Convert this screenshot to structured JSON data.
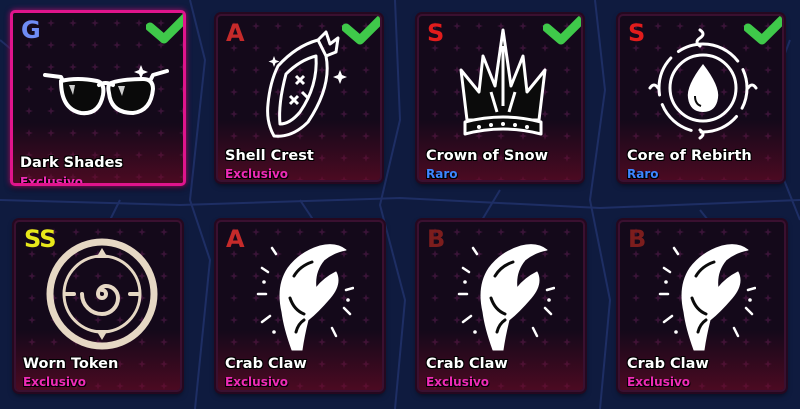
{
  "colors": {
    "grade_G": "#6f8cf5",
    "grade_A": "#c62a2a",
    "grade_S": "#e11c1c",
    "grade_SS": "#e8e81a",
    "grade_B": "#7c1d1d",
    "rarity_exclusivo": "#ef2bb6",
    "rarity_raro": "#3d86ff",
    "check": "#3fc94a"
  },
  "items": [
    {
      "grade": "G",
      "name": "Dark Shades",
      "rarity": "Exclusivo",
      "icon": "sunglasses-icon",
      "equipped": true
    },
    {
      "grade": "A",
      "name": "Shell Crest",
      "rarity": "Exclusivo",
      "icon": "shell-crest-icon",
      "equipped": true
    },
    {
      "grade": "S",
      "name": "Crown of Snow",
      "rarity": "Raro",
      "icon": "crown-icon",
      "equipped": true
    },
    {
      "grade": "S",
      "name": "Core of Rebirth",
      "rarity": "Raro",
      "icon": "water-drop-icon",
      "equipped": true
    },
    {
      "grade": "SS",
      "name": "Worn Token",
      "rarity": "Exclusivo",
      "icon": "spiral-token-icon",
      "equipped": false
    },
    {
      "grade": "A",
      "name": "Crab Claw",
      "rarity": "Exclusivo",
      "icon": "crab-claw-icon",
      "equipped": false
    },
    {
      "grade": "B",
      "name": "Crab Claw",
      "rarity": "Exclusivo",
      "icon": "crab-claw-icon",
      "equipped": false
    },
    {
      "grade": "B",
      "name": "Crab Claw",
      "rarity": "Exclusivo",
      "icon": "crab-claw-icon",
      "equipped": false
    }
  ]
}
